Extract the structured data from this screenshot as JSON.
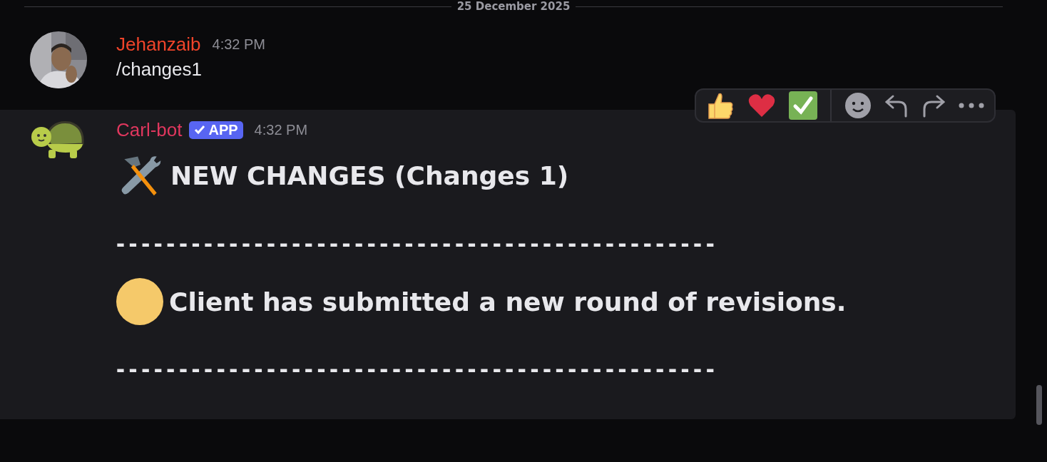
{
  "date_divider": "25 December 2025",
  "messages": [
    {
      "author": "Jehanzaib",
      "color": "#f0442a",
      "time": "4:32 PM",
      "kind": "user",
      "hovered": false,
      "content": [
        {
          "kind": "plain",
          "text": "/changes1"
        }
      ]
    },
    {
      "author": "Carl-bot",
      "color": "#e0375e",
      "badge": "APP",
      "time": "4:32 PM",
      "kind": "bot",
      "hovered": true,
      "content": [
        {
          "kind": "title",
          "text": "NEW CHANGES (Changes 1)"
        },
        {
          "kind": "rule",
          "text": "------------------------------------------------"
        },
        {
          "kind": "bullet",
          "text": "Client has submitted a new round of revisions."
        },
        {
          "kind": "rule",
          "text": "------------------------------------------------"
        }
      ]
    }
  ]
}
